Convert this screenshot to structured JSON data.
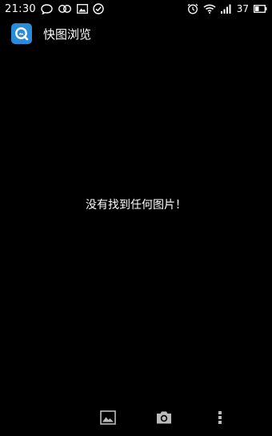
{
  "status_bar": {
    "time": "21:30",
    "battery_level": "37",
    "left_icons": [
      "chat-bubble-icon",
      "infinity-icon",
      "image-icon",
      "check-circle-icon"
    ],
    "right_icons": [
      "alarm-icon",
      "wifi-icon",
      "signal-icon",
      "battery-icon"
    ]
  },
  "app_bar": {
    "title": "快图浏览",
    "logo_color": "#2a8bd8"
  },
  "main": {
    "empty_message": "没有找到任何图片！"
  },
  "toolbar": {
    "items": [
      "gallery-icon",
      "camera-icon",
      "overflow-menu-icon"
    ]
  }
}
